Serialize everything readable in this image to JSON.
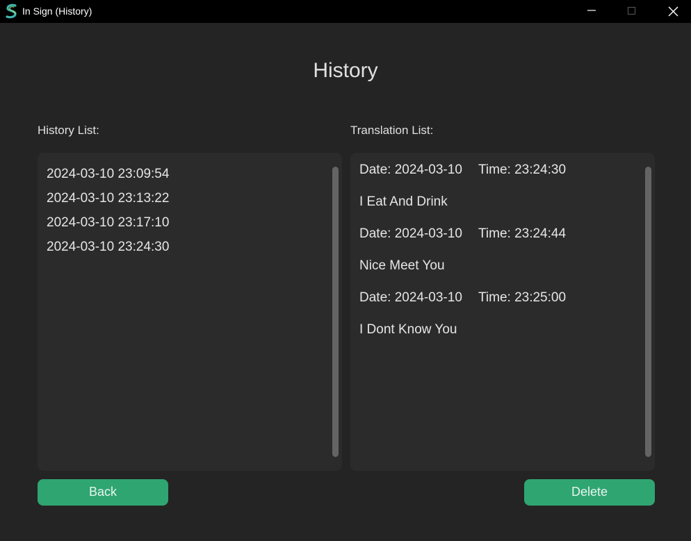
{
  "window": {
    "title": "In Sign (History)",
    "icon": "app-logo-icon",
    "accent": "#2fa572",
    "background": "#242424"
  },
  "page": {
    "title": "History"
  },
  "history_panel": {
    "label": "History List:",
    "items": [
      "2024-03-10 23:09:54",
      "2024-03-10 23:13:22",
      "2024-03-10 23:17:10",
      "2024-03-10 23:24:30"
    ]
  },
  "translation_panel": {
    "label": "Translation List:",
    "entries": [
      {
        "date": "Date: 2024-03-10",
        "time": "Time: 23:24:30",
        "text": "I Eat And Drink"
      },
      {
        "date": "Date: 2024-03-10",
        "time": "Time: 23:24:44",
        "text": "Nice Meet You"
      },
      {
        "date": "Date: 2024-03-10",
        "time": "Time: 23:25:00",
        "text": "I Dont Know You"
      }
    ]
  },
  "buttons": {
    "back": "Back",
    "delete": "Delete"
  }
}
